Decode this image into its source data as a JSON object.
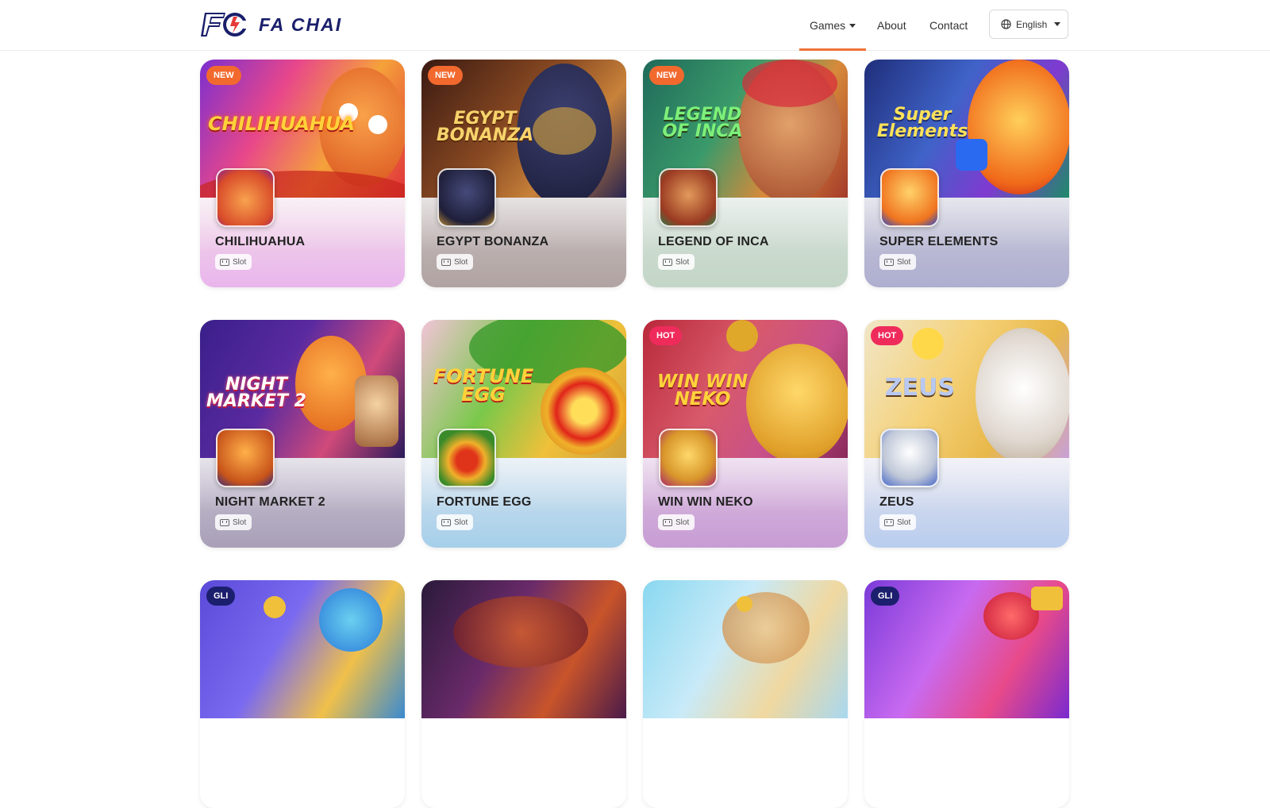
{
  "brand": {
    "name": "FA CHAI",
    "mark": "FC"
  },
  "nav": {
    "games": "Games",
    "about": "About",
    "contact": "Contact",
    "language": "English"
  },
  "cards": [
    {
      "title": "CHILIHUAHUA",
      "tag": "Slot",
      "badge": "NEW",
      "art_text": "CHILIHUAHUA"
    },
    {
      "title": "EGYPT BONANZA",
      "tag": "Slot",
      "badge": "NEW",
      "art_text": "EGYPT BONANZA"
    },
    {
      "title": "LEGEND OF INCA",
      "tag": "Slot",
      "badge": "NEW",
      "art_text": "LEGEND OF INCA"
    },
    {
      "title": "SUPER ELEMENTS",
      "tag": "Slot",
      "badge": "",
      "art_text": "Super Elements"
    },
    {
      "title": "NIGHT MARKET 2",
      "tag": "Slot",
      "badge": "",
      "art_text": "NIGHT MARKET 2"
    },
    {
      "title": "FORTUNE EGG",
      "tag": "Slot",
      "badge": "",
      "art_text": "FORTUNE EGG"
    },
    {
      "title": "WIN WIN NEKO",
      "tag": "Slot",
      "badge": "HOT",
      "art_text": "WIN WIN NEKO"
    },
    {
      "title": "ZEUS",
      "tag": "Slot",
      "badge": "HOT",
      "art_text": "ZEUS"
    },
    {
      "title": "",
      "tag": "",
      "badge": "GLI",
      "art_text": ""
    },
    {
      "title": "",
      "tag": "",
      "badge": "",
      "art_text": ""
    },
    {
      "title": "",
      "tag": "",
      "badge": "",
      "art_text": ""
    },
    {
      "title": "",
      "tag": "",
      "badge": "GLI",
      "art_text": ""
    }
  ],
  "colors": {
    "accent": "#f07236",
    "brand": "#1a1f6b",
    "new_badge": "#f2692e",
    "hot_badge": "#ef2b5c",
    "gli_badge": "#1c1f6e"
  }
}
